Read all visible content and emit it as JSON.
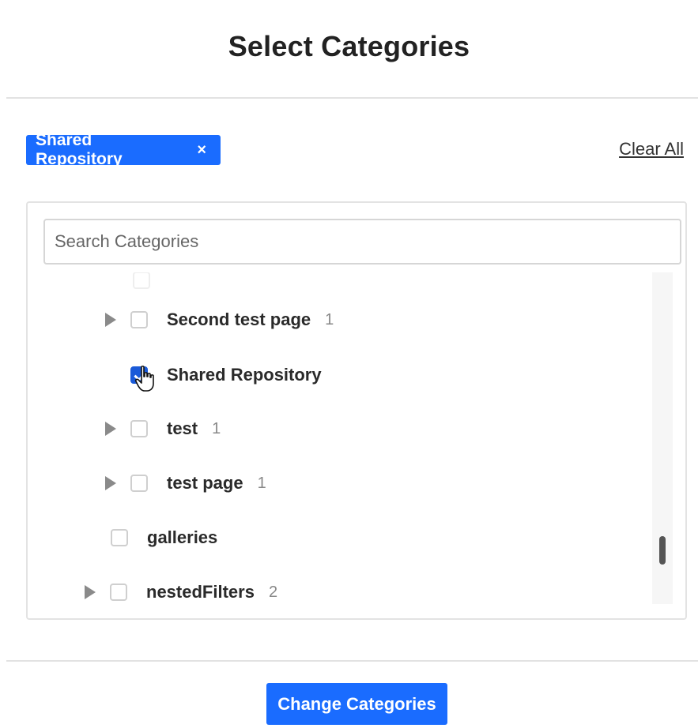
{
  "dialog": {
    "title": "Select Categories"
  },
  "selected_chip": {
    "label": "Shared Repository",
    "remove_symbol": "×"
  },
  "clear_all_label": "Clear All",
  "search": {
    "placeholder": "Search Categories",
    "value": ""
  },
  "tree": {
    "items": [
      {
        "label": "Second test page",
        "count": "1",
        "expandable": true,
        "checked": false,
        "level": 2
      },
      {
        "label": "Shared Repository",
        "count": "",
        "expandable": false,
        "checked": true,
        "level": 2
      },
      {
        "label": "test",
        "count": "1",
        "expandable": true,
        "checked": false,
        "level": 2
      },
      {
        "label": "test page",
        "count": "1",
        "expandable": true,
        "checked": false,
        "level": 2
      },
      {
        "label": "galleries",
        "count": "",
        "expandable": false,
        "checked": false,
        "level": 1
      },
      {
        "label": "nestedFilters",
        "count": "2",
        "expandable": true,
        "checked": false,
        "level": 1
      }
    ]
  },
  "footer": {
    "submit_label": "Change Categories"
  },
  "colors": {
    "accent": "#1a6cff",
    "checked": "#1a5ad8",
    "divider": "#e2e2e2"
  },
  "icons": {
    "chip_remove": "close-icon",
    "expand": "caret-right-icon",
    "cursor": "hand-pointer-icon"
  }
}
